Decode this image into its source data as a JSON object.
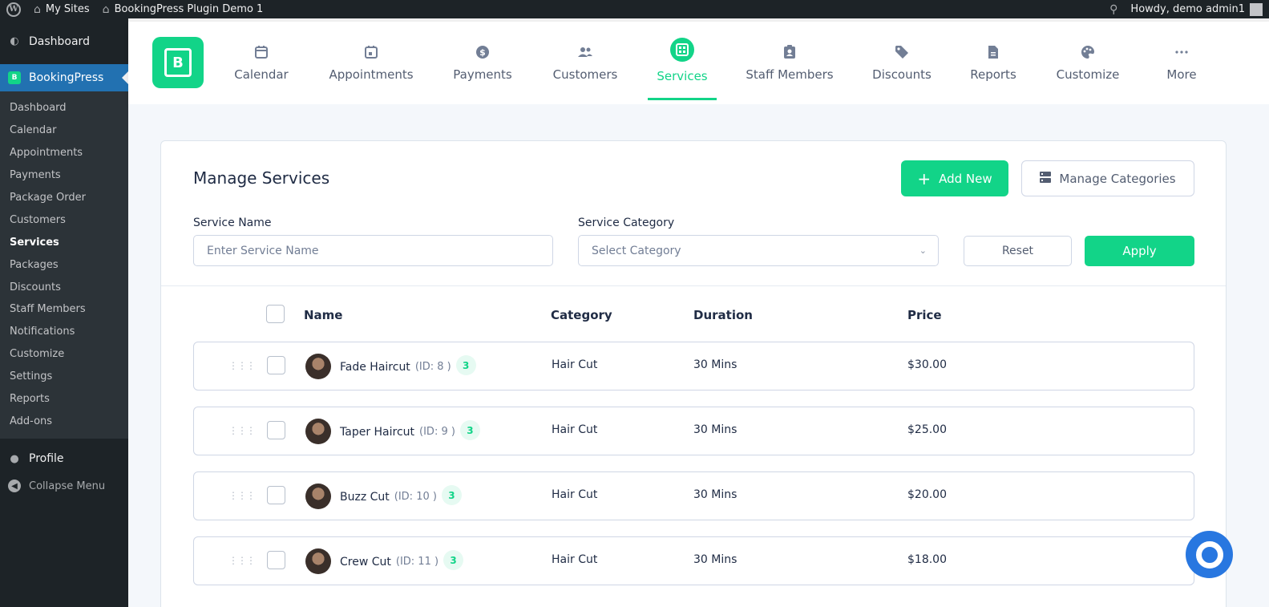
{
  "adminbar": {
    "my_sites": "My Sites",
    "site_name": "BookingPress Plugin Demo 1",
    "howdy": "Howdy, demo admin1"
  },
  "sidebar": {
    "dashboard": "Dashboard",
    "bookingpress": "BookingPress",
    "submenu": [
      "Dashboard",
      "Calendar",
      "Appointments",
      "Payments",
      "Package Order",
      "Customers",
      "Services",
      "Packages",
      "Discounts",
      "Staff Members",
      "Notifications",
      "Customize",
      "Settings",
      "Reports",
      "Add-ons"
    ],
    "profile": "Profile",
    "collapse": "Collapse Menu"
  },
  "nav": {
    "items": [
      "Calendar",
      "Appointments",
      "Payments",
      "Customers",
      "Services",
      "Staff Members",
      "Discounts",
      "Reports",
      "Customize",
      "More"
    ],
    "active": "Services"
  },
  "page": {
    "title": "Manage Services",
    "add_new": "Add New",
    "manage_categories": "Manage Categories",
    "service_name_label": "Service Name",
    "service_name_placeholder": "Enter Service Name",
    "service_category_label": "Service Category",
    "service_category_placeholder": "Select Category",
    "reset": "Reset",
    "apply": "Apply"
  },
  "table": {
    "headers": [
      "Name",
      "Category",
      "Duration",
      "Price"
    ],
    "rows": [
      {
        "name": "Fade Haircut",
        "id": "(ID: 8 )",
        "count": "3",
        "category": "Hair Cut",
        "duration": "30 Mins",
        "price": "$30.00"
      },
      {
        "name": "Taper Haircut",
        "id": "(ID: 9 )",
        "count": "3",
        "category": "Hair Cut",
        "duration": "30 Mins",
        "price": "$25.00"
      },
      {
        "name": "Buzz Cut",
        "id": "(ID: 10 )",
        "count": "3",
        "category": "Hair Cut",
        "duration": "30 Mins",
        "price": "$20.00"
      },
      {
        "name": "Crew Cut",
        "id": "(ID: 11 )",
        "count": "3",
        "category": "Hair Cut",
        "duration": "30 Mins",
        "price": "$18.00"
      }
    ]
  },
  "colors": {
    "accent": "#12d488",
    "admin_bar": "#1d2327",
    "sidebar_active": "#2271b1",
    "help_button": "#2877e0"
  }
}
